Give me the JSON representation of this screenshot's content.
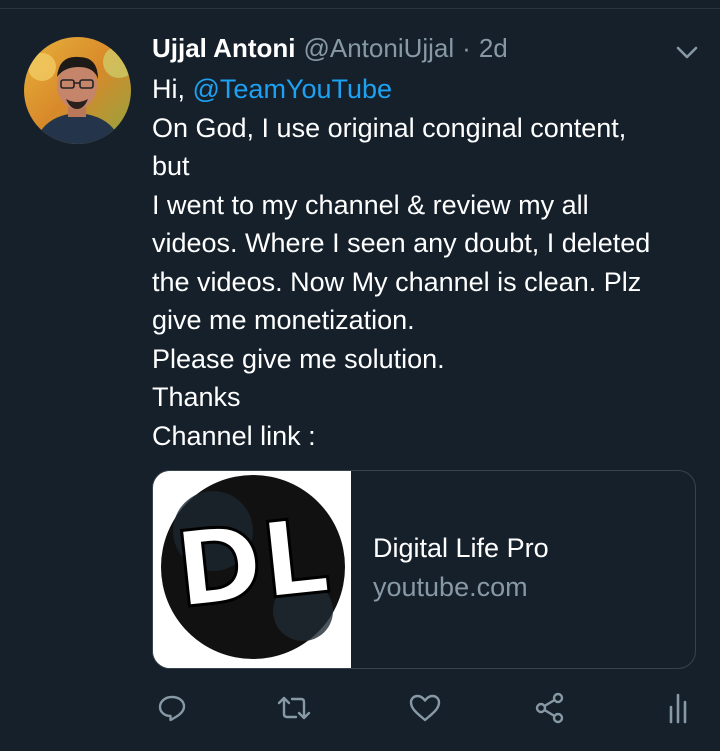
{
  "tweet": {
    "author_name": "Ujjal Antoni",
    "author_handle": "@AntoniUjjal",
    "separator": "·",
    "timestamp": "2d",
    "greeting": "Hi, ",
    "mention": "@TeamYouTube",
    "lines": [
      "On God, I use original conginal content,",
      "but",
      "I went to my channel & review my all",
      "videos. Where I seen any doubt, I deleted",
      "the videos. Now My channel is clean. Plz",
      "give me monetization.",
      "Please give me solution.",
      "Thanks",
      "Channel link :"
    ]
  },
  "link_card": {
    "title": "Digital Life Pro",
    "domain": "youtube.com",
    "logo_text": "DL"
  },
  "actions": {
    "icons": [
      "reply-icon",
      "retweet-icon",
      "like-icon",
      "share-icon",
      "analytics-icon"
    ]
  },
  "colors": {
    "background": "#15202b",
    "text": "#ffffff",
    "secondary_text": "#8899a6",
    "link": "#1da1f2",
    "border": "#38444d"
  }
}
